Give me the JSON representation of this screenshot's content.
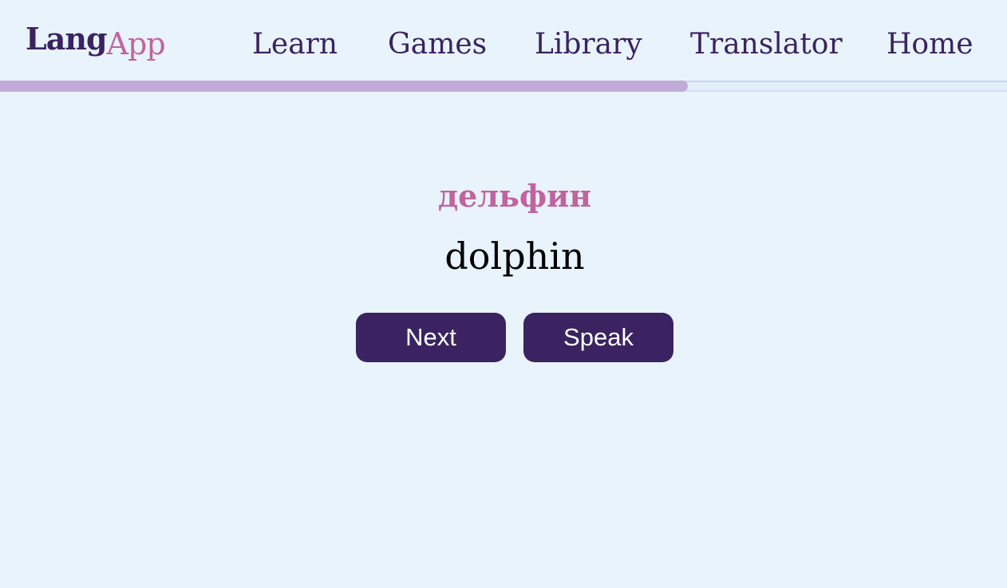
{
  "header": {
    "logo": {
      "part1": "Lang",
      "part2": "App"
    },
    "nav": [
      {
        "label": "Learn"
      },
      {
        "label": "Games"
      },
      {
        "label": "Library"
      },
      {
        "label": "Translator"
      },
      {
        "label": "Home"
      }
    ]
  },
  "progress": {
    "fraction": 0.683
  },
  "card": {
    "foreign_word": "дельфин",
    "native_word": "dolphin"
  },
  "actions": {
    "next_label": "Next",
    "speak_label": "Speak"
  },
  "colors": {
    "background": "#e8f3fc",
    "primary": "#3a2360",
    "accent": "#c064a0",
    "progress_fill": "#c3abd9"
  }
}
